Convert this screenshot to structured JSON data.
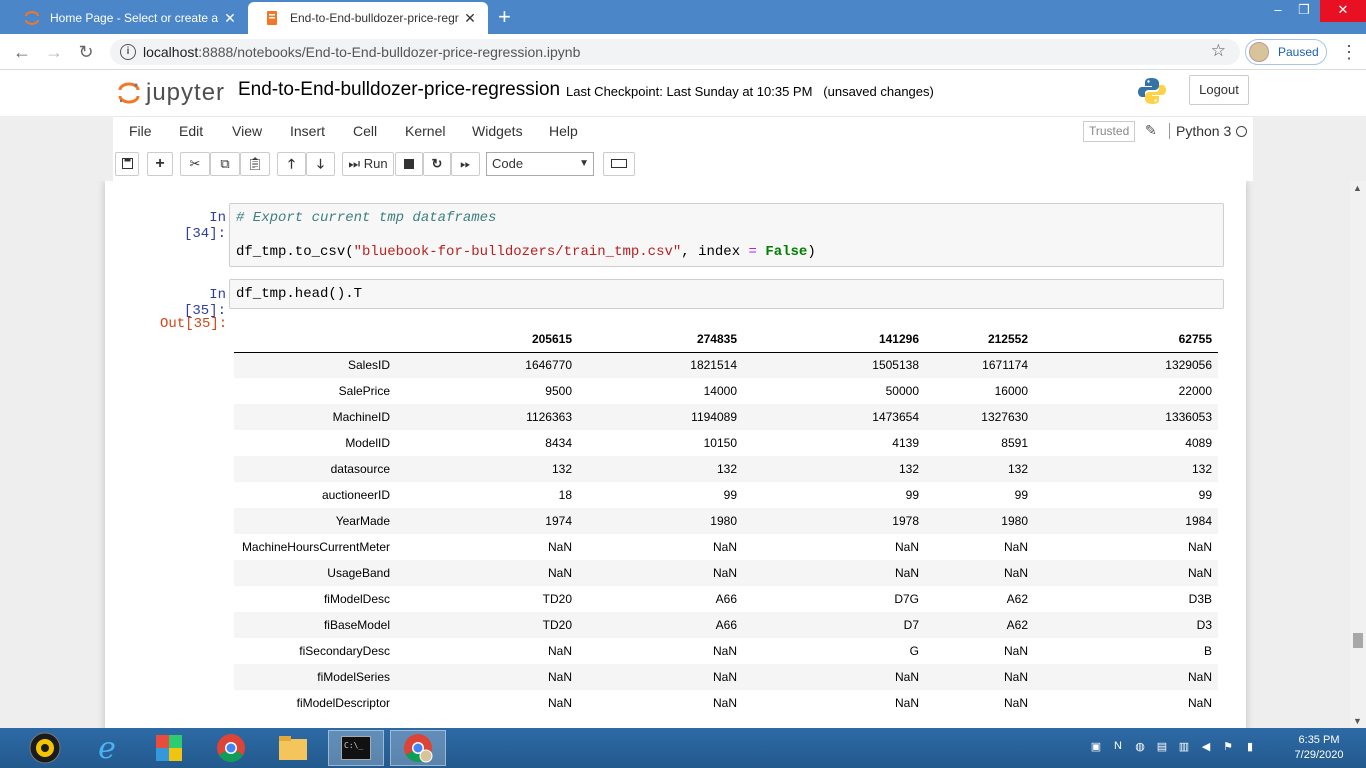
{
  "browser": {
    "tabs": [
      {
        "title": "Home Page - Select or create a n",
        "active": false
      },
      {
        "title": "End-to-End-bulldozer-price-regr",
        "active": true
      }
    ],
    "url_host": "localhost",
    "url_rest": ":8888/notebooks/End-to-End-bulldozer-price-regression.ipynb",
    "profile_label": "Paused"
  },
  "jupyter": {
    "logo_text": "jupyter",
    "notebook_title": "End-to-End-bulldozer-price-regression",
    "checkpoint": "Last Checkpoint: Last Sunday at 10:35 PM",
    "unsaved": "(unsaved changes)",
    "logout_label": "Logout",
    "menu": [
      "File",
      "Edit",
      "View",
      "Insert",
      "Cell",
      "Kernel",
      "Widgets",
      "Help"
    ],
    "trusted_label": "Trusted",
    "kernel_name": "Python 3",
    "run_label": "Run",
    "cell_type": "Code"
  },
  "cells": {
    "cell34": {
      "prompt": "In [34]:",
      "comment": "# Export current tmp dataframes",
      "line2_pre": "df_tmp.to_csv(",
      "line2_str": "\"bluebook-for-bulldozers/train_tmp.csv\"",
      "line2_mid": ", index ",
      "line2_op": "=",
      "line2_kw": "False",
      "line2_post": ")"
    },
    "cell35": {
      "prompt": "In [35]:",
      "code": "df_tmp.head().T",
      "out_prompt": "Out[35]:"
    }
  },
  "table": {
    "columns": [
      "205615",
      "274835",
      "141296",
      "212552",
      "62755"
    ],
    "rows": [
      {
        "label": "SalesID",
        "values": [
          "1646770",
          "1821514",
          "1505138",
          "1671174",
          "1329056"
        ]
      },
      {
        "label": "SalePrice",
        "values": [
          "9500",
          "14000",
          "50000",
          "16000",
          "22000"
        ]
      },
      {
        "label": "MachineID",
        "values": [
          "1126363",
          "1194089",
          "1473654",
          "1327630",
          "1336053"
        ]
      },
      {
        "label": "ModelID",
        "values": [
          "8434",
          "10150",
          "4139",
          "8591",
          "4089"
        ]
      },
      {
        "label": "datasource",
        "values": [
          "132",
          "132",
          "132",
          "132",
          "132"
        ]
      },
      {
        "label": "auctioneerID",
        "values": [
          "18",
          "99",
          "99",
          "99",
          "99"
        ]
      },
      {
        "label": "YearMade",
        "values": [
          "1974",
          "1980",
          "1978",
          "1980",
          "1984"
        ]
      },
      {
        "label": "MachineHoursCurrentMeter",
        "values": [
          "NaN",
          "NaN",
          "NaN",
          "NaN",
          "NaN"
        ]
      },
      {
        "label": "UsageBand",
        "values": [
          "NaN",
          "NaN",
          "NaN",
          "NaN",
          "NaN"
        ]
      },
      {
        "label": "fiModelDesc",
        "values": [
          "TD20",
          "A66",
          "D7G",
          "A62",
          "D3B"
        ]
      },
      {
        "label": "fiBaseModel",
        "values": [
          "TD20",
          "A66",
          "D7",
          "A62",
          "D3"
        ]
      },
      {
        "label": "fiSecondaryDesc",
        "values": [
          "NaN",
          "NaN",
          "G",
          "NaN",
          "B"
        ]
      },
      {
        "label": "fiModelSeries",
        "values": [
          "NaN",
          "NaN",
          "NaN",
          "NaN",
          "NaN"
        ]
      },
      {
        "label": "fiModelDescriptor",
        "values": [
          "NaN",
          "NaN",
          "NaN",
          "NaN",
          "NaN"
        ]
      }
    ]
  },
  "taskbar": {
    "time": "6:35 PM",
    "date": "7/29/2020"
  },
  "colors": {
    "in_prompt": "#303f9f",
    "out_prompt": "#d84315",
    "tabstrip": "#4a86c8",
    "taskbar": "#2d6aa5"
  }
}
